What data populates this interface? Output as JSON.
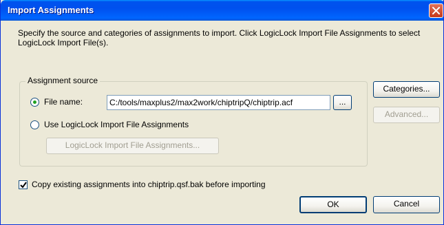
{
  "window": {
    "title": "Import Assignments",
    "close_icon": "close-x-icon"
  },
  "description": "Specify the source and categories of assignments to import. Click LogicLock Import File Assignments to select LogicLock Import File(s).",
  "assignment_source": {
    "legend": "Assignment source",
    "file_name_label": "File name:",
    "file_name_selected": true,
    "file_name_value": "C:/tools/maxplus2/max2work/chiptripQ/chiptrip.acf",
    "browse_label": "...",
    "logiclock_label": "Use LogicLock Import File Assignments",
    "logiclock_selected": false,
    "logiclock_button_label": "LogicLock Import File Assignments..."
  },
  "side_buttons": {
    "categories_label": "Categories...",
    "advanced_label": "Advanced..."
  },
  "copy_option": {
    "label": "Copy existing assignments into chiptrip.qsf.bak before importing",
    "checked": true
  },
  "footer": {
    "ok_label": "OK",
    "cancel_label": "Cancel"
  },
  "colors": {
    "titlebar": "#0058ee",
    "dialog_bg": "#ece9d8",
    "close_button": "#d8532f",
    "radio_dot": "#21a121"
  }
}
